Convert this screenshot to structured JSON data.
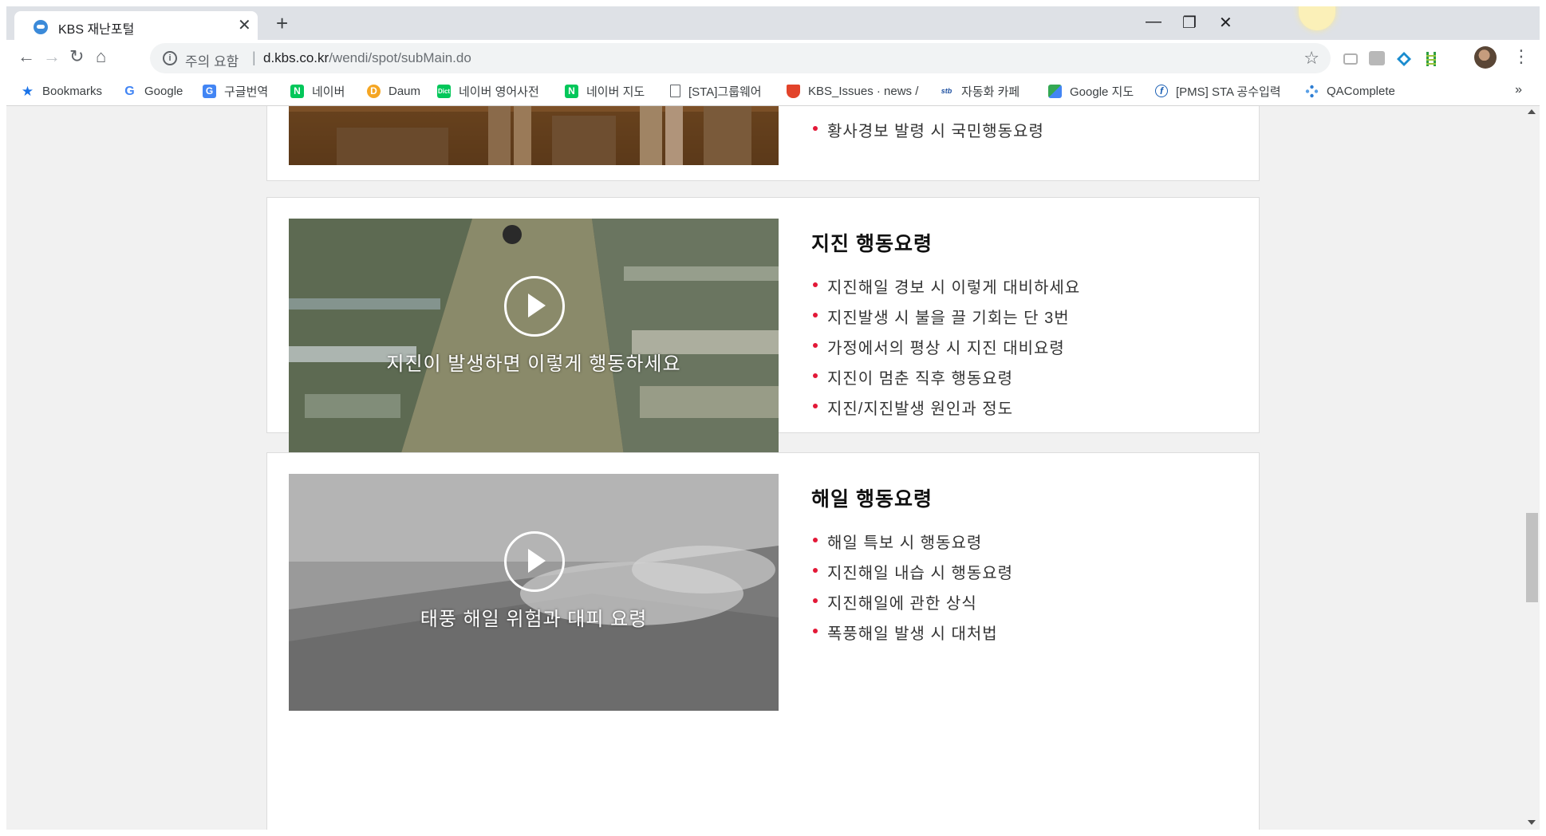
{
  "browser": {
    "tab_title": "KBS 재난포털",
    "tab_close": "✕",
    "new_tab": "+",
    "security_label": "주의 요함",
    "url_host": "d.kbs.co.kr",
    "url_path": "/wendi/spot/subMain.do",
    "window_controls": {
      "minimize": "—",
      "restore": "❐",
      "close": "✕"
    },
    "nav": {
      "back": "←",
      "forward": "→",
      "reload": "↻",
      "home": "⌂"
    },
    "star": "☆",
    "menu": "⋮"
  },
  "bookmarks": {
    "items": [
      {
        "label": "Bookmarks",
        "icon": "star-icon",
        "color": "#1a73e8"
      },
      {
        "label": "Google",
        "icon": "google-icon",
        "color": "#4285f4"
      },
      {
        "label": "구글번역",
        "icon": "translate-icon",
        "color": "#4285f4"
      },
      {
        "label": "네이버",
        "icon": "naver-icon",
        "color": "#03c75a"
      },
      {
        "label": "Daum",
        "icon": "daum-icon",
        "color": "#f5a623"
      },
      {
        "label": "네이버 영어사전",
        "icon": "naver-dict-icon",
        "color": "#03c75a"
      },
      {
        "label": "네이버 지도",
        "icon": "naver-map-icon",
        "color": "#03c75a"
      },
      {
        "label": "[STA]그룹웨어",
        "icon": "page-icon",
        "color": "#5f6368"
      },
      {
        "label": "KBS_Issues · news / ",
        "icon": "gitlab-icon",
        "color": "#e2432a"
      },
      {
        "label": "자동화 카페",
        "icon": "cafe-icon",
        "color": "#1c4fa0"
      },
      {
        "label": "Google 지도",
        "icon": "google-maps-icon",
        "color": "#34a853"
      },
      {
        "label": "[PMS] STA 공수입력",
        "icon": "pms-icon",
        "color": "#1a5fb4"
      },
      {
        "label": "QAComplete",
        "icon": "qacomplete-icon",
        "color": "#2d7dd2"
      }
    ],
    "more": "»"
  },
  "page": {
    "partial_item": "황사경보 발령 시 국민행동요령",
    "sections": [
      {
        "title": "지진 행동요령",
        "video_caption": "지진이 발생하면 이렇게 행동하세요",
        "items": [
          "지진해일 경보 시 이렇게 대비하세요",
          "지진발생 시 불을 끌 기회는 단 3번",
          "가정에서의 평상 시 지진 대비요령",
          "지진이 멈춘 직후 행동요령",
          "지진/지진발생 원인과 정도"
        ]
      },
      {
        "title": "해일 행동요령",
        "video_caption": "태풍 해일 위험과 대피 요령",
        "items": [
          "해일 특보 시 행동요령",
          "지진해일 내습 시 행동요령",
          "지진해일에 관한 상식",
          "폭풍해일 발생 시 대처법"
        ]
      }
    ]
  },
  "colors": {
    "bullet": "#e31837",
    "tabstrip": "#dee1e6"
  }
}
